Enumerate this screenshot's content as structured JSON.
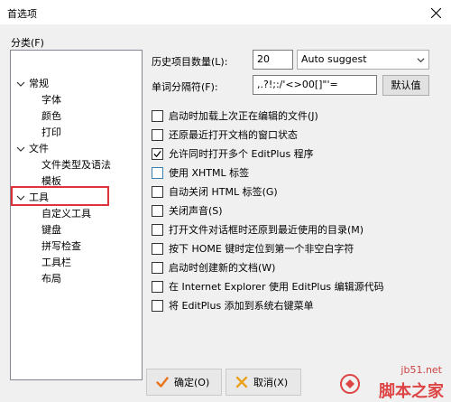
{
  "window": {
    "title": "首选项"
  },
  "category_label": "分类(F)",
  "tree": {
    "groups": [
      {
        "label": "常规",
        "children": [
          "字体",
          "颜色",
          "打印"
        ]
      },
      {
        "label": "文件",
        "children": [
          "文件类型及语法",
          "模板"
        ]
      },
      {
        "label": "工具",
        "children": [
          "自定义工具",
          "键盘",
          "拼写检查",
          "工具栏",
          "布局"
        ]
      }
    ],
    "highlighted": "工具"
  },
  "settings": {
    "history_label": "历史项目数量(L):",
    "history_value": "20",
    "suggest_value": "Auto suggest",
    "separator_label": "单词分隔符(F):",
    "separator_value": ",.?!;:/'<>00[]\"'=",
    "default_button": "默认值"
  },
  "checkboxes": [
    {
      "label": "启动时加载上次正在编辑的文件(J)",
      "checked": false
    },
    {
      "label": "还原最近打开文档的窗口状态",
      "checked": false
    },
    {
      "label": "允许同时打开多个 EditPlus 程序",
      "checked": true
    },
    {
      "label": "使用 XHTML 标签",
      "checked": false
    },
    {
      "label": "自动关闭 HTML 标签(G)",
      "checked": false
    },
    {
      "label": "关闭声音(S)",
      "checked": false
    },
    {
      "label": "打开文件对话框时还原到最近使用的目录(M)",
      "checked": false
    },
    {
      "label": "按下 HOME 键时定位到第一个非空白字符",
      "checked": false
    },
    {
      "label": "启动时创建新的文档(W)",
      "checked": false
    },
    {
      "label": "在 Internet Explorer 使用 EditPlus 编辑源代码",
      "checked": false
    },
    {
      "label": "将 EditPlus 添加到系统右键菜单",
      "checked": false
    }
  ],
  "buttons": {
    "ok": "确定(O)",
    "cancel": "取消(X)"
  },
  "watermark": {
    "url": "jb51.net",
    "brand": "脚本之家"
  },
  "colors": {
    "highlight_box": "#e0303a",
    "ok_check": "#e8731b",
    "cancel_x": "#e8a21b",
    "focus_checkbox": "#3c7fb1"
  }
}
